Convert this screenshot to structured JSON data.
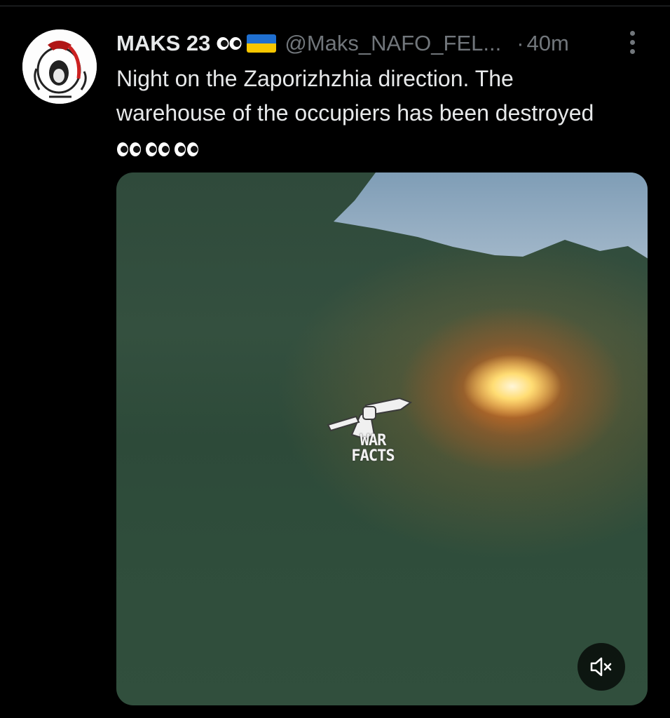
{
  "tweet": {
    "author_name": "MAKS 23",
    "handle": "@Maks_NAFO_FEL...",
    "separator": "·",
    "timestamp": "40m",
    "text": "Night on the Zaporizhzhia direction.  The warehouse of the occupiers has been destroyed",
    "name_badges": [
      "eyes-emoji",
      "ukraine-flag-emoji"
    ],
    "text_emojis_count": 3
  },
  "media": {
    "watermark_text_line1": "WAR",
    "watermark_text_line2": "FACTS",
    "mute_icon": "volume-muted-icon"
  },
  "colors": {
    "background": "#000000",
    "primary_text": "#e7e9ea",
    "secondary_text": "#71767b",
    "flag_blue": "#1f6fd0",
    "flag_yellow": "#f7c600"
  }
}
